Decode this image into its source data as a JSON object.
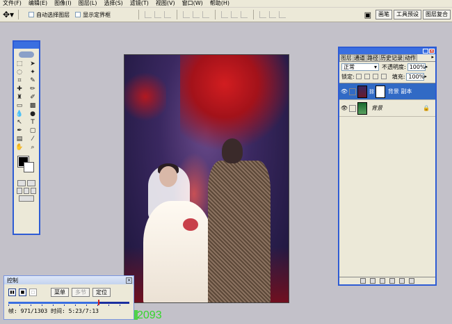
{
  "menubar": {
    "items": [
      "文件(F)",
      "编辑(E)",
      "图像(I)",
      "图层(L)",
      "选择(S)",
      "滤镜(T)",
      "视图(V)",
      "窗口(W)",
      "帮助(H)"
    ]
  },
  "options": {
    "tool_icon": "move-tool-icon",
    "auto_select_layer": "自动选择图层",
    "show_bounding_box": "显示定界框",
    "well_tabs": [
      "画笔",
      "工具预设",
      "图层复合"
    ]
  },
  "layers_panel": {
    "tabs": [
      "图层",
      "通道",
      "路径",
      "历史记录",
      "动作"
    ],
    "blend_mode": "正常",
    "opacity_label": "不透明度:",
    "opacity_value": "100%",
    "lock_label": "锁定:",
    "fill_label": "填充:",
    "fill_value": "100%",
    "layers": [
      {
        "name": "背景 副本",
        "selected": true
      },
      {
        "name": "背景",
        "selected": false,
        "locked": true
      }
    ]
  },
  "control_panel": {
    "title": "控制",
    "menu_button": "菜单",
    "multi_button": "多节",
    "locate_button": "定位",
    "status": "帧: 971/1303 时间: 5:23/7:13",
    "progress": 0.745
  },
  "overlay_text": "2093",
  "colors": {
    "accent": "#3a6fe0",
    "overlay_green": "#34d62a",
    "track": "#1a2fa0"
  }
}
